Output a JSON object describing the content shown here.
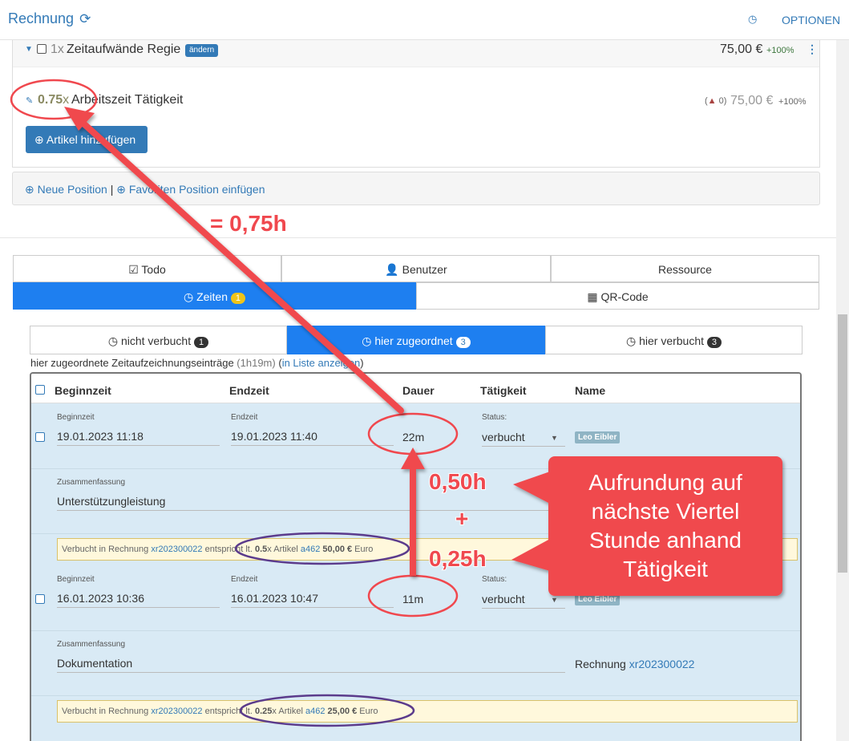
{
  "header": {
    "title": "Rechnung",
    "refresh_icon": "⟳",
    "clock_icon": "◷",
    "options_label": "OPTIONEN"
  },
  "position": {
    "qty": "1x",
    "title": "Zeitaufwände Regie",
    "edit_label": "ändern",
    "price": "75,00 €",
    "pct": "+100%",
    "menu_icon": "⋮"
  },
  "article": {
    "pencil_icon": "✎",
    "qty_value": "0.75",
    "qty_x": "x",
    "title": "Arbeitszeit Tätigkeit",
    "warn_count": "0)",
    "warn_open": "(",
    "price": "75,00 €",
    "pct": "+100%",
    "add_button": "Artikel hinzufügen"
  },
  "newbar": {
    "new_position": "Neue Position",
    "sep": "|",
    "fav_position": "Favoriten Position einfügen"
  },
  "tabs_row1": {
    "todo": "Todo",
    "benutzer": "Benutzer",
    "ressource": "Ressource"
  },
  "tabs_row2": {
    "zeiten": "Zeiten",
    "zeiten_count": "1",
    "qr": "QR-Code"
  },
  "tabs_row3": {
    "nicht_verbucht": "nicht verbucht",
    "nicht_count": "1",
    "hier_zugeordnet": "hier zugeordnet",
    "hier_count": "3",
    "hier_verbucht": "hier verbucht",
    "verbucht_count": "3"
  },
  "entries": {
    "label": "hier zugeordnete Zeitaufzeichnungseinträge",
    "total": "(1h19m)",
    "paren_open": "(",
    "link": "in Liste anzeigen",
    "paren_close": ")"
  },
  "table": {
    "headers": {
      "start": "Beginnzeit",
      "end": "Endzeit",
      "duration": "Dauer",
      "activity": "Tätigkeit",
      "name": "Name"
    },
    "rows": [
      {
        "start_lbl": "Beginnzeit",
        "start": "19.01.2023 11:18",
        "end_lbl": "Endzeit",
        "end": "19.01.2023 11:40",
        "duration": "22m",
        "status_lbl": "Status:",
        "status": "verbucht",
        "name": "Leo Eibler",
        "summary_lbl": "Zusammenfassung",
        "summary": "Unterstützungleistung",
        "booked_prefix": "Verbucht in Rechnung",
        "booked_invoice": "xr202300022",
        "booked_mid": "entspricht lt.",
        "booked_qty": "0.5",
        "booked_x": "x Artikel",
        "booked_article": "a462",
        "booked_amount": "50,00 €",
        "booked_unit": "Euro"
      },
      {
        "start_lbl": "Beginnzeit",
        "start": "16.01.2023 10:36",
        "end_lbl": "Endzeit",
        "end": "16.01.2023 10:47",
        "duration": "11m",
        "status_lbl": "Status:",
        "status": "verbucht",
        "name": "Leo Eibler",
        "summary_lbl": "Zusammenfassung",
        "summary": "Dokumentation",
        "invoice_label": "Rechnung",
        "invoice_link": "xr202300022",
        "booked_prefix": "Verbucht in Rechnung",
        "booked_invoice": "xr202300022",
        "booked_mid": "entspricht lt.",
        "booked_qty": "0.25",
        "booked_x": "x Artikel",
        "booked_article": "a462",
        "booked_amount": "25,00 €",
        "booked_unit": "Euro"
      }
    ]
  },
  "annotations": {
    "eq_hours": "= 0,75h",
    "h050": "0,50h",
    "plus": "+",
    "h025": "0,25h",
    "callout_lines": [
      "Aufrundung auf",
      "nächste Viertel",
      "Stunde anhand",
      "Tätigkeit"
    ]
  },
  "colors": {
    "accent": "#337ab7",
    "tab_active": "#1e7ff0",
    "annotation_red": "#f0484e",
    "annotation_purple": "#5b3b8c",
    "row_bg": "#d9eaf5"
  }
}
